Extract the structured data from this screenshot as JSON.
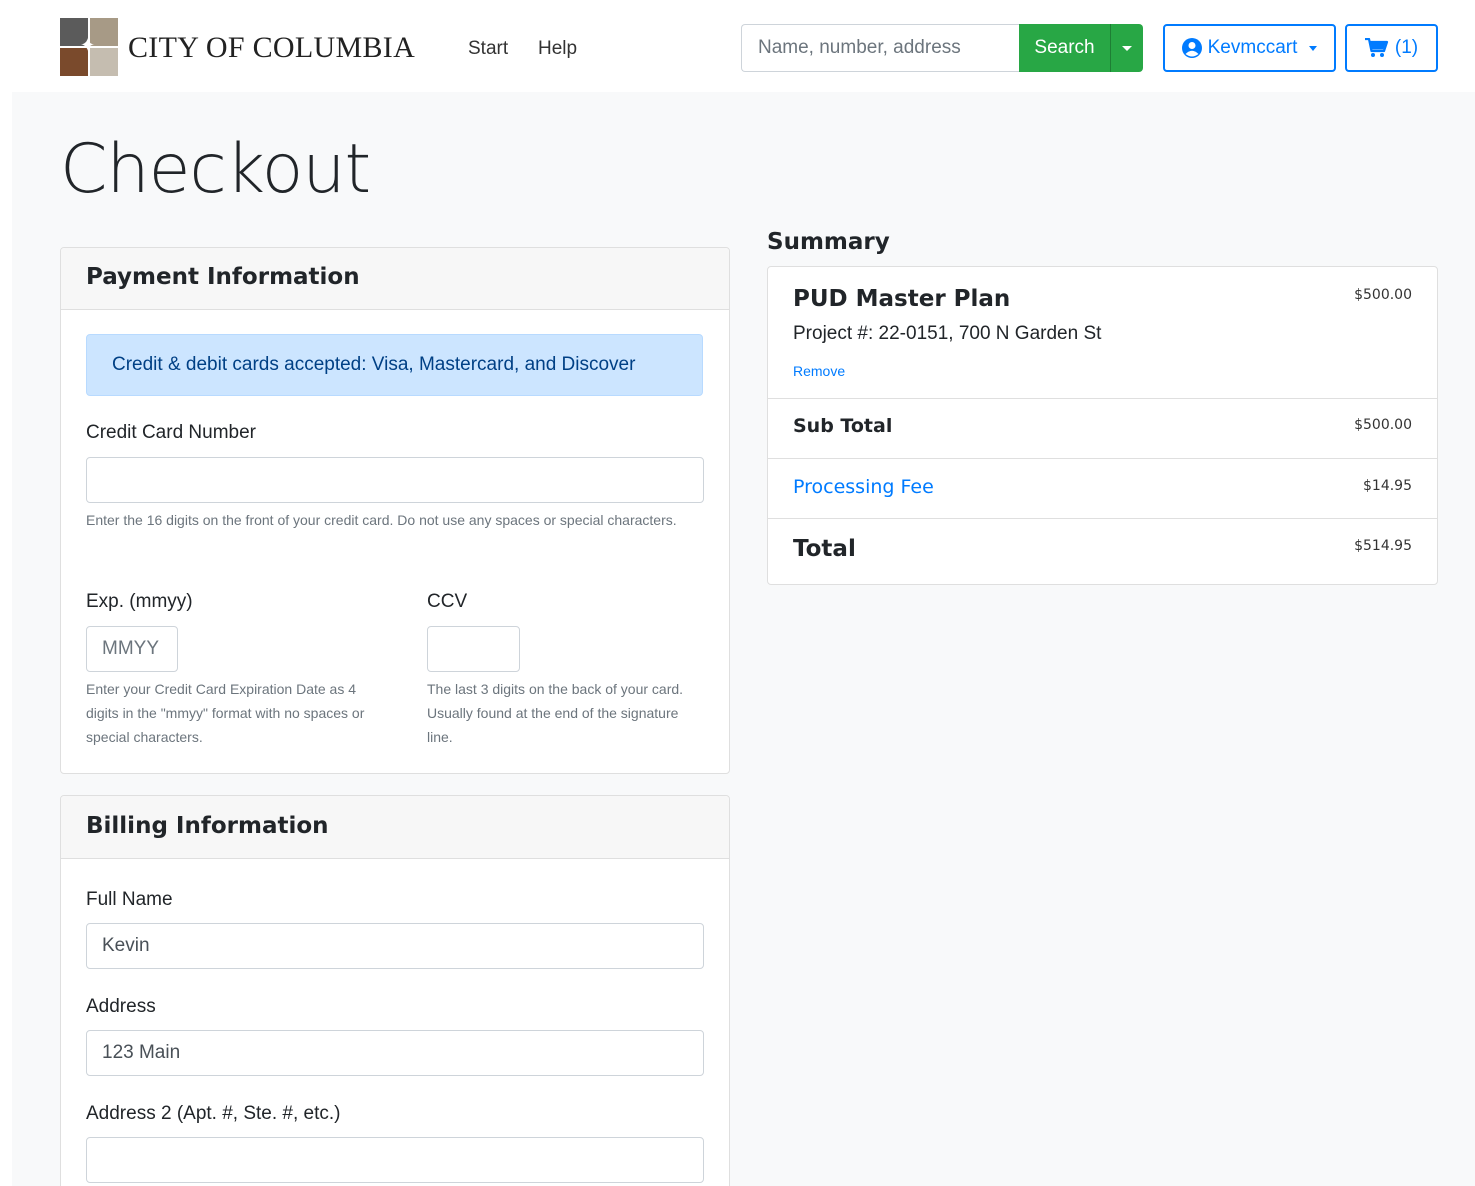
{
  "nav": {
    "brand": "CITY OF COLUMBIA",
    "links": [
      "Start",
      "Help"
    ],
    "search_placeholder": "Name, number, address",
    "search_label": "Search",
    "user_label": "Kevmccart",
    "cart_label": "(1)"
  },
  "page": {
    "title": "Checkout"
  },
  "payment": {
    "header": "Payment Information",
    "alert": "Credit & debit cards accepted: Visa, Mastercard, and Discover",
    "card_number_label": "Credit Card Number",
    "card_number_value": "",
    "card_number_help": "Enter the 16 digits on the front of your credit card. Do not use any spaces or special characters.",
    "exp_label": "Exp. (mmyy)",
    "exp_placeholder": "MMYY",
    "exp_help": "Enter your Credit Card Expiration Date as 4 digits in the \"mmyy\" format with no spaces or special characters.",
    "ccv_label": "CCV",
    "ccv_help": "The last 3 digits on the back of your card. Usually found at the end of the signature line."
  },
  "billing": {
    "header": "Billing Information",
    "full_name_label": "Full Name",
    "full_name_value": "Kevin",
    "address_label": "Address",
    "address_value": "123 Main",
    "address2_label": "Address 2 (Apt. #, Ste. #, etc.)",
    "address2_value": ""
  },
  "summary": {
    "title": "Summary",
    "item_name": "PUD Master Plan",
    "item_detail": "Project #: 22-0151, 700 N Garden St",
    "item_amount": "$500.00",
    "remove_label": "Remove",
    "subtotal_label": "Sub Total",
    "subtotal_amount": "$500.00",
    "fee_label": "Processing Fee",
    "fee_amount": "$14.95",
    "total_label": "Total",
    "total_amount": "$514.95"
  },
  "colors": {
    "primary": "#007bff",
    "success": "#28a745",
    "alert_bg": "#cce5ff",
    "logo": [
      "#5b5b5b",
      "#a79a86",
      "#7a4a2c",
      "#c5bdb0"
    ]
  }
}
